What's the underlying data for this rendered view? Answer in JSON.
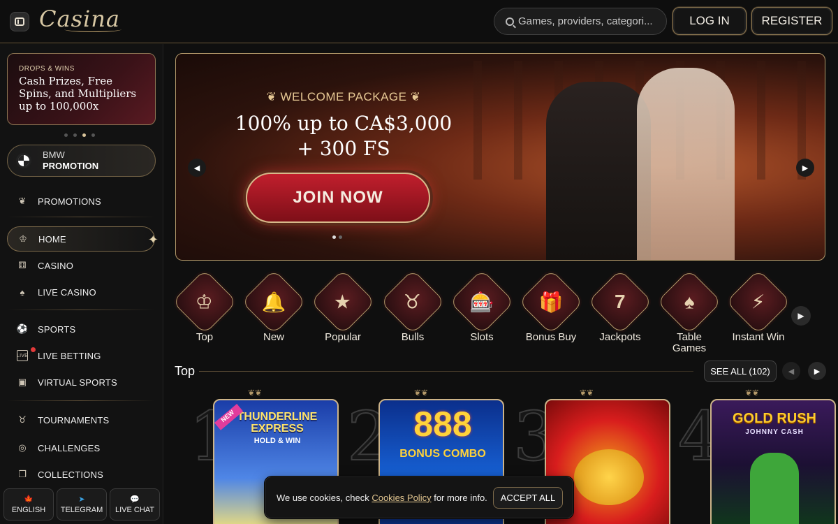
{
  "header": {
    "logo": "Casina",
    "search_placeholder": "Games, providers, categori...",
    "login": "LOG IN",
    "register": "REGISTER"
  },
  "sidebar": {
    "promo_card": {
      "eyebrow": "DROPS & WINS",
      "title": "Cash Prizes, Free Spins, and Multipliers up to 100,000x"
    },
    "bmw": {
      "line1": "BMW",
      "line2": "PROMOTION"
    },
    "items": [
      {
        "label": "PROMOTIONS",
        "icon": "promotions-icon"
      },
      {
        "label": "HOME",
        "icon": "crown-icon",
        "active": true
      },
      {
        "label": "CASINO",
        "icon": "dice-icon"
      },
      {
        "label": "LIVE CASINO",
        "icon": "cards-icon"
      },
      {
        "label": "SPORTS",
        "icon": "soccer-ball-icon"
      },
      {
        "label": "LIVE BETTING",
        "icon": "live-icon"
      },
      {
        "label": "VIRTUAL SPORTS",
        "icon": "virtual-sports-icon"
      },
      {
        "label": "TOURNAMENTS",
        "icon": "bull-icon"
      },
      {
        "label": "CHALLENGES",
        "icon": "target-icon"
      },
      {
        "label": "COLLECTIONS",
        "icon": "collections-icon"
      }
    ],
    "bottom": {
      "language": "ENGLISH",
      "telegram": "TELEGRAM",
      "live_chat": "LIVE CHAT"
    }
  },
  "hero": {
    "eyebrow": "WELCOME PACKAGE",
    "title_line1": "100% up to CA$3,000",
    "title_line2": "+ 300 FS",
    "cta": "JOIN NOW"
  },
  "categories": [
    {
      "label": "Top",
      "icon": "crown-icon"
    },
    {
      "label": "New",
      "icon": "bell-icon"
    },
    {
      "label": "Popular",
      "icon": "star-icon"
    },
    {
      "label": "Bulls",
      "icon": "bull-icon"
    },
    {
      "label": "Slots",
      "icon": "slot-machine-icon"
    },
    {
      "label": "Bonus Buy",
      "icon": "gift-icon"
    },
    {
      "label": "Jackpots",
      "icon": "seven-icon"
    },
    {
      "label": "Table Games",
      "icon": "playing-cards-icon"
    },
    {
      "label": "Instant Win",
      "icon": "lightning-icon"
    }
  ],
  "top_section": {
    "title": "Top",
    "see_all": "SEE ALL (102)",
    "games": [
      {
        "rank": "1",
        "title": "THUNDERLINE EXPRESS",
        "subtitle": "HOLD & WIN",
        "badge": "NEW"
      },
      {
        "rank": "2",
        "title": "888",
        "subtitle": "BONUS COMBO"
      },
      {
        "rank": "3",
        "title": "",
        "subtitle": ""
      },
      {
        "rank": "4",
        "title": "GOLD RUSH",
        "subtitle": "JOHNNY CASH"
      }
    ]
  },
  "cookie": {
    "text_before": "We use cookies, check ",
    "link": "Cookies Policy",
    "text_after": " for more info.",
    "accept": "ACCEPT ALL"
  }
}
